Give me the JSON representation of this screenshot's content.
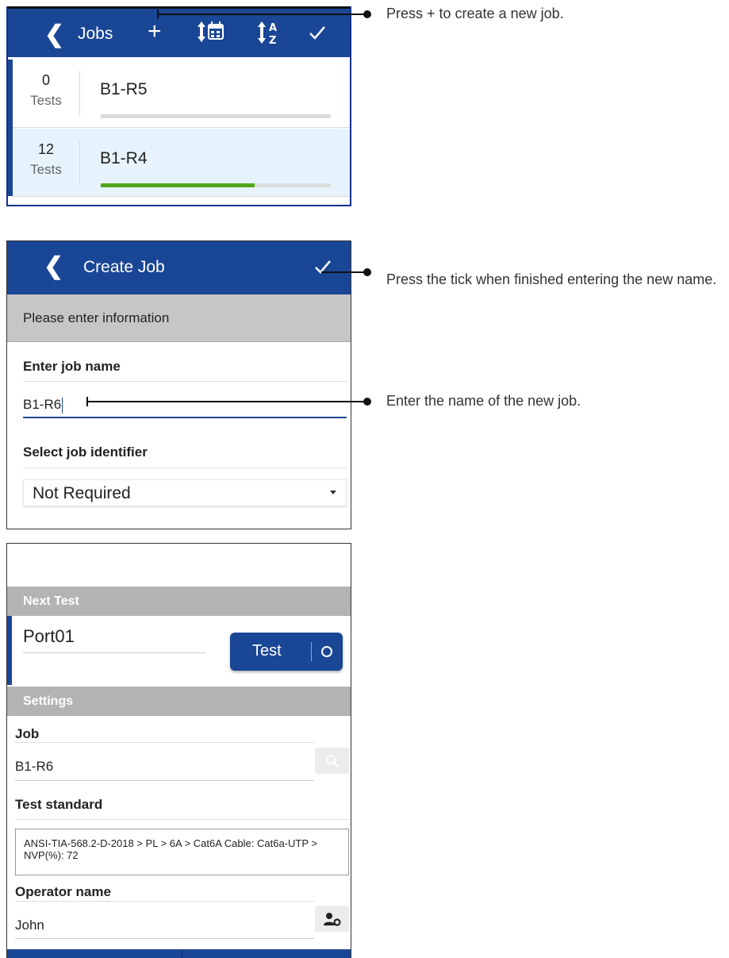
{
  "jobs_screen": {
    "title": "Jobs",
    "toolbar": {
      "add": "+",
      "sort_date": "sort-by-date-icon",
      "sort_alpha": "sort-alphabetical-icon",
      "confirm": "check-icon"
    },
    "rows": [
      {
        "count": "0",
        "unit": "Tests",
        "name": "B1-R5",
        "progress": 0.0
      },
      {
        "count": "12",
        "unit": "Tests",
        "name": "B1-R4",
        "progress": 0.67
      }
    ]
  },
  "create_job_screen": {
    "title": "Create Job",
    "info_header": "Please enter information",
    "name_label": "Enter job name",
    "name_value": "B1-R6",
    "identifier_label": "Select job identifier",
    "identifier_value": "Not Required"
  },
  "test_screen": {
    "next_test_header": "Next Test",
    "port_name": "Port01",
    "test_button": "Test",
    "settings_header": "Settings",
    "job_label": "Job",
    "job_value": "B1-R6",
    "standard_label": "Test standard",
    "standard_value": "ANSI-TIA-568.2-D-2018 > PL > 6A > Cat6A Cable: Cat6a-UTP > NVP(%): 72",
    "operator_label": "Operator name",
    "operator_value": "John"
  },
  "callouts": {
    "add_job": "Press + to create a new job.",
    "tick": "Press the tick when finished entering the new name.",
    "enter_name": "Enter the name of the new job."
  },
  "colors": {
    "primary": "#1a4696",
    "progress": "#4ea61a",
    "section": "#b3b3b3"
  }
}
